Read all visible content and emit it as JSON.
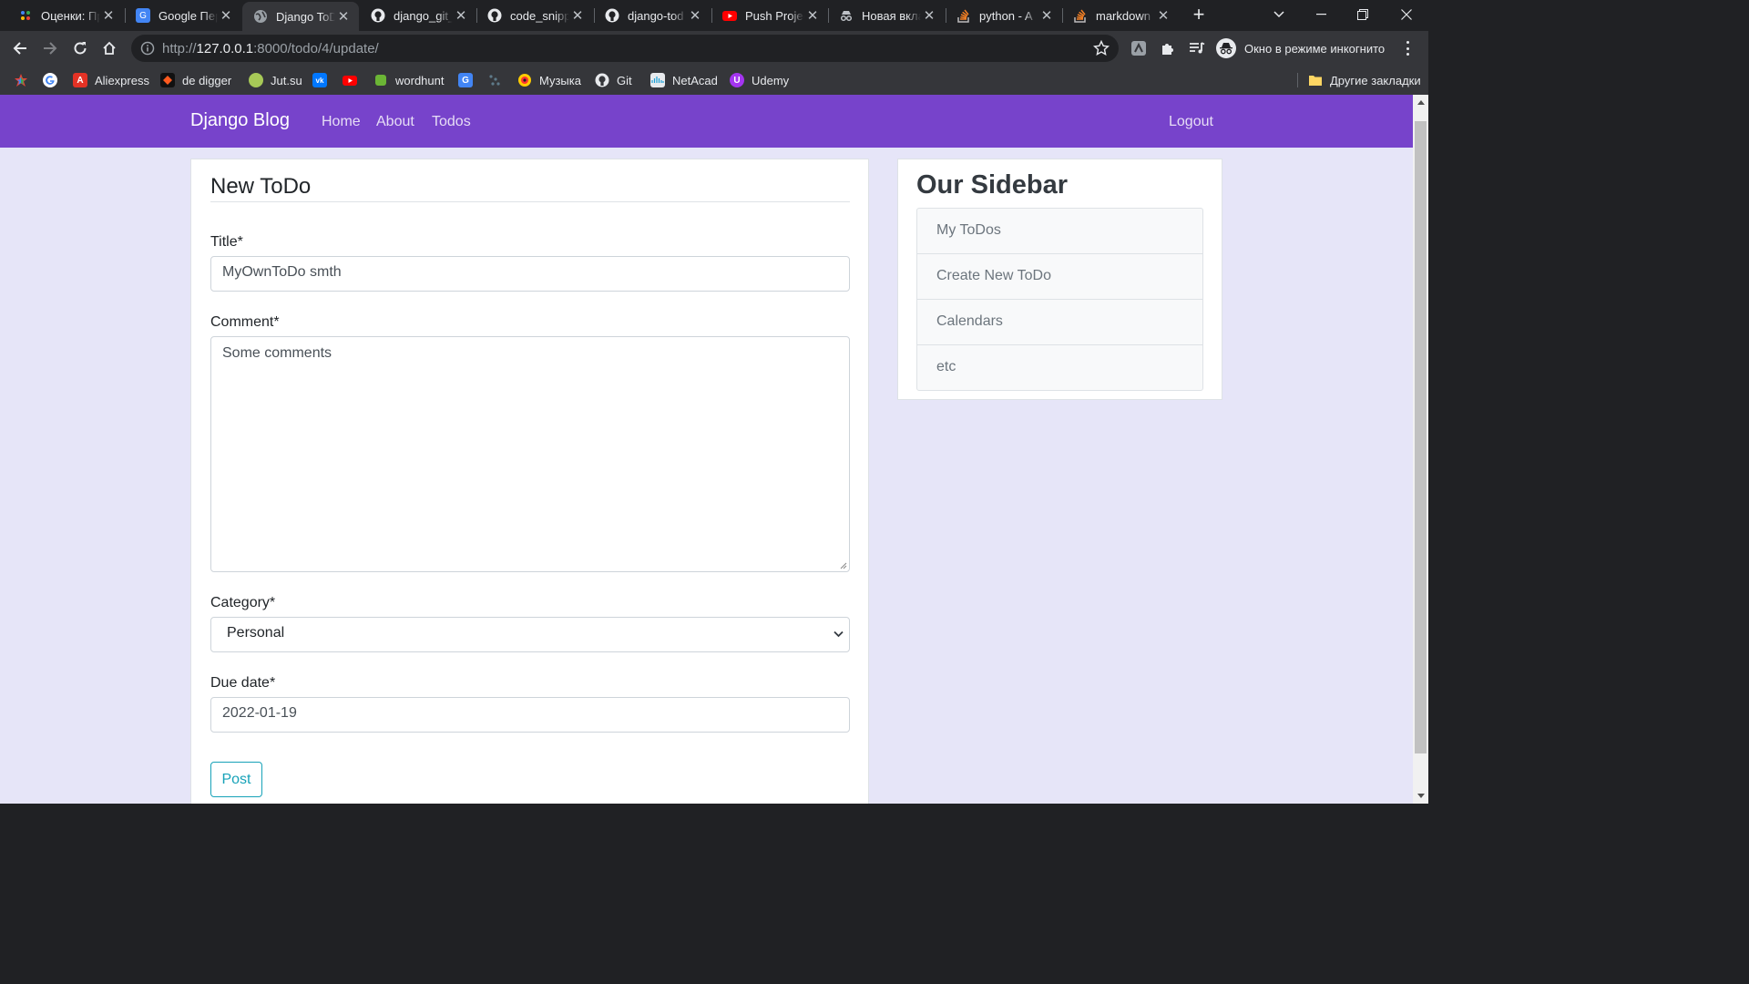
{
  "browser": {
    "tabs": [
      {
        "title": "Оценки: Пр",
        "favicon": "apps-icon",
        "active": false
      },
      {
        "title": "Google Пер",
        "favicon": "translate-icon",
        "active": false
      },
      {
        "title": "Django ToD",
        "favicon": "globe-icon",
        "active": true
      },
      {
        "title": "django_git_",
        "favicon": "github-icon",
        "active": false
      },
      {
        "title": "code_snipp",
        "favicon": "github-icon",
        "active": false
      },
      {
        "title": "django-tod",
        "favicon": "github-icon",
        "active": false
      },
      {
        "title": "Push Projec",
        "favicon": "youtube-icon",
        "active": false
      },
      {
        "title": "Новая вкла",
        "favicon": "incognito-icon",
        "active": false
      },
      {
        "title": "python - A",
        "favicon": "stackoverflow-icon",
        "active": false
      },
      {
        "title": "markdown",
        "favicon": "stackoverflow-icon",
        "active": false
      }
    ],
    "url_scheme": "http://",
    "url_host": "127.0.0.1",
    "url_path": ":8000/todo/4/update/",
    "incognito_label": "Окно в режиме инкогнито",
    "bookmarks": [
      {
        "label": "",
        "icon": "apps-icon"
      },
      {
        "label": "",
        "icon": "google-icon"
      },
      {
        "label": "Aliexpress",
        "icon": "aliexpress-icon"
      },
      {
        "label": "de digger",
        "icon": "dedigger-icon"
      },
      {
        "label": "Jut.su",
        "icon": "jutsu-icon"
      },
      {
        "label": "",
        "icon": "vk-icon"
      },
      {
        "label": "",
        "icon": "youtube-icon"
      },
      {
        "label": "wordhunt",
        "icon": "wordhunt-icon"
      },
      {
        "label": "",
        "icon": "translate-icon"
      },
      {
        "label": "",
        "icon": "dots-icon"
      },
      {
        "label": "Музыка",
        "icon": "music-icon"
      },
      {
        "label": "Git",
        "icon": "github-icon"
      },
      {
        "label": "NetAcad",
        "icon": "netacad-icon"
      },
      {
        "label": "Udemy",
        "icon": "udemy-icon"
      }
    ],
    "other_bookmarks": "Другие закладки"
  },
  "site": {
    "brand": "Django Blog",
    "nav": [
      "Home",
      "About",
      "Todos"
    ],
    "logout": "Logout"
  },
  "form": {
    "heading": "New ToDo",
    "title_label": "Title*",
    "title_value": "MyOwnToDo smth",
    "comment_label": "Comment*",
    "comment_value": "Some comments",
    "category_label": "Category*",
    "category_value": "Personal",
    "due_label": "Due date*",
    "due_value": "2022-01-19",
    "submit": "Post"
  },
  "sidebar": {
    "title": "Our Sidebar",
    "items": [
      "My ToDos",
      "Create New ToDo",
      "Calendars",
      "etc"
    ]
  },
  "colors": {
    "navbar": "#7743cb",
    "page_bg": "#e6e5f8",
    "button_outline": "#17a2b8"
  }
}
